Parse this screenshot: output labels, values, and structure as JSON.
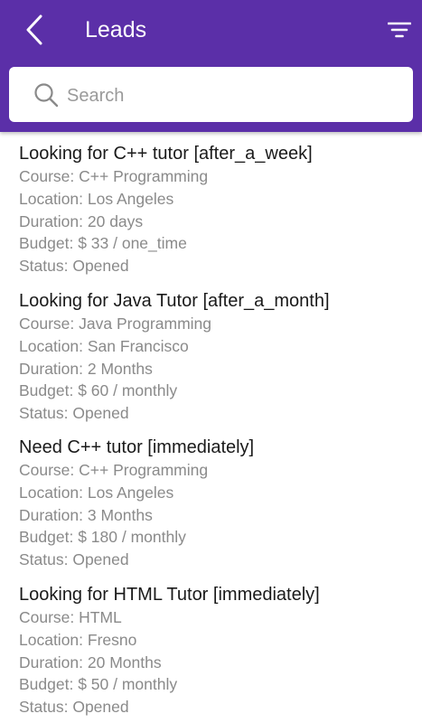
{
  "header": {
    "title": "Leads"
  },
  "search": {
    "placeholder": "Search"
  },
  "icons": {
    "back": "chevron-left-icon",
    "filter": "filter-icon",
    "search": "search-icon"
  },
  "colors": {
    "header_bg": "#5b2fa8",
    "title_text": "#1a1a1a",
    "detail_text": "#8a8a8a"
  },
  "leads": [
    {
      "title": "Looking for C++ tutor [after_a_week]",
      "course": "Course: C++ Programming",
      "location": "Location: Los Angeles",
      "duration": "Duration: 20 days",
      "budget": "Budget: $ 33 / one_time",
      "status": "Status: Opened"
    },
    {
      "title": "Looking for Java Tutor [after_a_month]",
      "course": "Course: Java Programming",
      "location": "Location: San Francisco",
      "duration": "Duration: 2 Months",
      "budget": "Budget: $ 60 / monthly",
      "status": "Status: Opened"
    },
    {
      "title": "Need C++ tutor [immediately]",
      "course": "Course: C++ Programming",
      "location": "Location: Los Angeles",
      "duration": "Duration: 3 Months",
      "budget": "Budget: $ 180 / monthly",
      "status": "Status: Opened"
    },
    {
      "title": "Looking for HTML Tutor [immediately]",
      "course": "Course: HTML",
      "location": "Location: Fresno",
      "duration": "Duration: 20 Months",
      "budget": "Budget: $ 50 / monthly",
      "status": "Status: Opened"
    }
  ]
}
